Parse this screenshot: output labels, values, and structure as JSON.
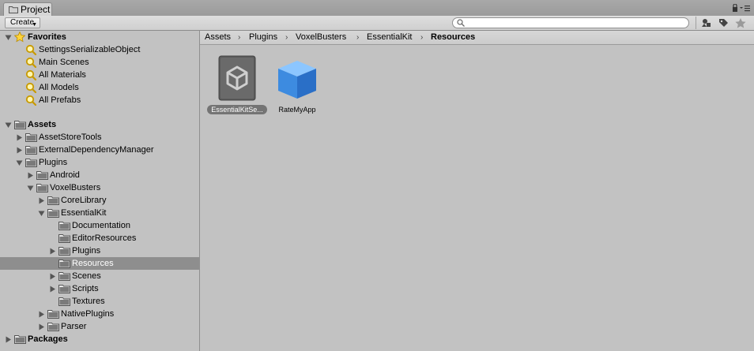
{
  "window": {
    "tab_label": "Project",
    "tab_icon": "folder-icon"
  },
  "toolbar": {
    "create_label": "Create",
    "search_value": "",
    "search_placeholder": "",
    "buttons": [
      "scene-filter-icon",
      "label-filter-icon",
      "star-filter-icon"
    ]
  },
  "favorites": {
    "label": "Favorites",
    "items": [
      {
        "label": "SettingsSerializableObject"
      },
      {
        "label": "Main Scenes"
      },
      {
        "label": "All Materials"
      },
      {
        "label": "All Models"
      },
      {
        "label": "All Prefabs"
      }
    ]
  },
  "tree": {
    "assets_label": "Assets",
    "asset_store_tools": "AssetStoreTools",
    "external_dependency_manager": "ExternalDependencyManager",
    "plugins": "Plugins",
    "android": "Android",
    "voxel_busters": "VoxelBusters",
    "core_library": "CoreLibrary",
    "essential_kit": "EssentialKit",
    "documentation": "Documentation",
    "editor_resources": "EditorResources",
    "ek_plugins": "Plugins",
    "resources": "Resources",
    "scenes": "Scenes",
    "scripts": "Scripts",
    "textures": "Textures",
    "native_plugins": "NativePlugins",
    "parser": "Parser",
    "packages_label": "Packages"
  },
  "breadcrumb": [
    "Assets",
    "Plugins",
    "VoxelBusters",
    "EssentialKit",
    "Resources"
  ],
  "assets": [
    {
      "name": "EssentialKitSe...",
      "icon": "unity-logo-icon",
      "selected": true
    },
    {
      "name": "RateMyApp",
      "icon": "prefab-cube-icon",
      "selected": false
    }
  ],
  "colors": {
    "panel_bg": "#c2c2c2",
    "selection_bg": "#8e8e8e",
    "folder": "#6e6e6e",
    "prefab_blue": "#4a9ae8"
  }
}
